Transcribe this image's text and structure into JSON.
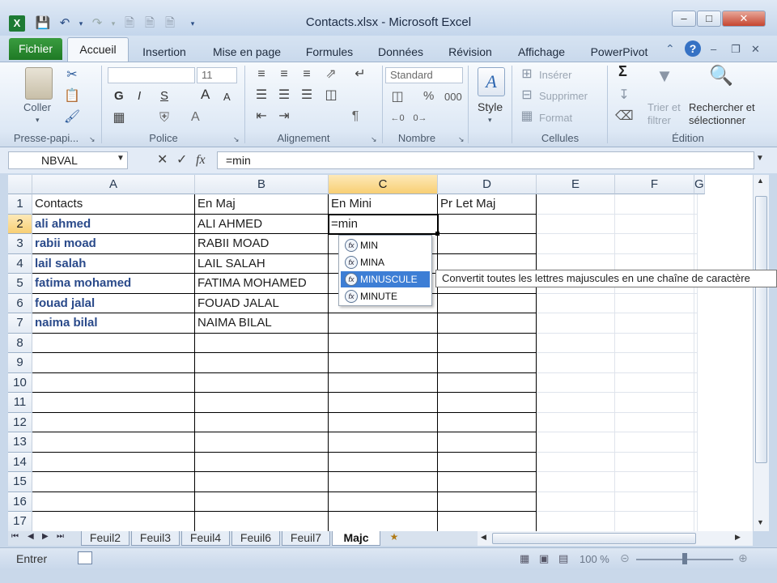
{
  "window": {
    "title": "Contacts.xlsx  -  Microsoft Excel",
    "controls": [
      "–",
      "□",
      "✕"
    ],
    "inner_controls": [
      "–",
      "❐",
      "✕"
    ]
  },
  "quick_access": [
    "excel-icon",
    "save-icon",
    "undo-icon",
    "redo-icon",
    "new-icon",
    "open-icon",
    "customize-icon"
  ],
  "tabs": {
    "file": "Fichier",
    "items": [
      "Accueil",
      "Insertion",
      "Mise en page",
      "Formules",
      "Données",
      "Révision",
      "Affichage",
      "PowerPivot"
    ]
  },
  "ribbon": {
    "clipboard": {
      "label": "Presse-papi...",
      "paste": "Coller"
    },
    "font": {
      "label": "Police",
      "name": "",
      "size": "11",
      "bold": "G",
      "italic": "I",
      "underline": "S",
      "grow": "A",
      "shrink": "A",
      "color": "A"
    },
    "alignment": {
      "label": "Alignement"
    },
    "number": {
      "label": "Nombre",
      "format": "Standard",
      "percent": "%",
      "thousands": "000"
    },
    "styles": {
      "label": "Style"
    },
    "cells": {
      "label": "Cellules",
      "insert": "Insérer",
      "delete": "Supprimer",
      "format": "Format"
    },
    "editing": {
      "label": "Édition",
      "sort": "Trier et",
      "sort2": "filtrer",
      "find": "Rechercher et",
      "find2": "sélectionner",
      "sigma": "Σ"
    }
  },
  "formula_bar": {
    "name_box": "NBVAL",
    "fx": "fx",
    "value": "=min"
  },
  "grid": {
    "columns": [
      "A",
      "B",
      "C",
      "D",
      "E",
      "F",
      "G"
    ],
    "selected_column": "C",
    "selected_row": 2,
    "rows": [
      [
        "Contacts",
        "En Maj",
        "En Mini",
        "Pr Let Maj"
      ],
      [
        "ali ahmed",
        "ALI AHMED",
        "=min",
        ""
      ],
      [
        "rabii moad",
        "RABII MOAD",
        "",
        ""
      ],
      [
        "lail salah",
        "LAIL SALAH",
        "",
        ""
      ],
      [
        "fatima mohamed",
        "FATIMA MOHAMED",
        "",
        ""
      ],
      [
        "fouad jalal",
        "FOUAD JALAL",
        "",
        ""
      ],
      [
        "naima bilal",
        "NAIMA BILAL",
        "",
        ""
      ],
      [
        "",
        "",
        "",
        ""
      ],
      [
        "",
        "",
        "",
        ""
      ],
      [
        "",
        "",
        "",
        ""
      ],
      [
        "",
        "",
        "",
        ""
      ],
      [
        "",
        "",
        "",
        ""
      ],
      [
        "",
        "",
        "",
        ""
      ],
      [
        "",
        "",
        "",
        ""
      ],
      [
        "",
        "",
        "",
        ""
      ],
      [
        "",
        "",
        "",
        ""
      ],
      [
        "",
        "",
        "",
        ""
      ]
    ]
  },
  "autocomplete": {
    "items": [
      "MIN",
      "MINA",
      "MINUSCULE",
      "MINUTE"
    ],
    "highlighted": 2,
    "tooltip": "Convertit toutes les lettres majuscules en une chaîne de caractère"
  },
  "sheets": {
    "tabs": [
      "Feuil2",
      "Feuil3",
      "Feuil4",
      "Feuil6",
      "Feuil7",
      "Majc"
    ],
    "active": "Majc"
  },
  "status": {
    "mode": "Entrer",
    "zoom": "100 %"
  }
}
